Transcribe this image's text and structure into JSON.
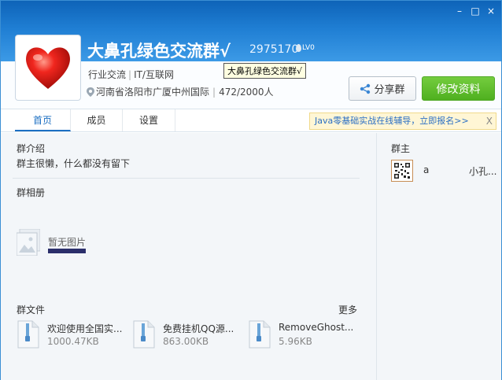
{
  "window": {
    "controls": {
      "min": "–",
      "max": "□",
      "close": "×"
    }
  },
  "group": {
    "name": "大鼻孔绿色交流群√",
    "id": "2975170",
    "level": "LV0",
    "tooltip": "大鼻孔绿色交流群√",
    "category": "行业交流",
    "subcategory": "IT/互联网",
    "location": "河南省洛阳市广厦中州国际",
    "members": "472/2000人"
  },
  "buttons": {
    "share": "分享群",
    "edit": "修改资料"
  },
  "tabs": {
    "home": "首页",
    "members": "成员",
    "settings": "设置"
  },
  "ad": {
    "text": "Java零基础实战在线辅导，立即报名>>",
    "close": "X"
  },
  "intro": {
    "title": "群介绍",
    "text": "群主很懒，什么都没有留下"
  },
  "album": {
    "title": "群相册",
    "empty": "暂无图片"
  },
  "files": {
    "title": "群文件",
    "more": "更多",
    "items": [
      {
        "name": "欢迎使用全国实...",
        "size": "1000.47KB"
      },
      {
        "name": "免费挂机QQ源...",
        "size": "863.00KB"
      },
      {
        "name": "RemoveGhost...",
        "size": "5.96KB"
      }
    ]
  },
  "owner": {
    "title": "群主",
    "name": "a",
    "nick": "小孔..."
  },
  "colors": {
    "header_blue": "#1f7ed3",
    "edit_green": "#5ab829",
    "tab_active": "#1c6fc2",
    "ad_bg": "#fff6d5"
  }
}
